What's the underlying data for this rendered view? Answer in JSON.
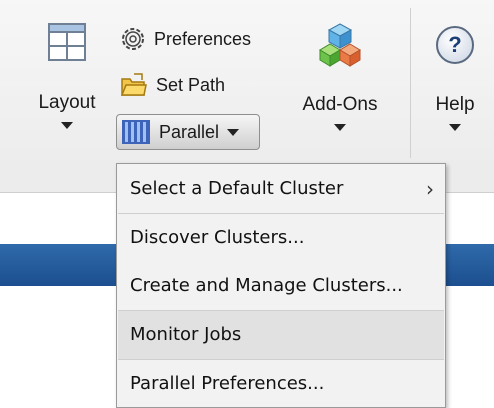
{
  "toolstrip": {
    "layout": {
      "label": "Layout",
      "icon": "layout-grid-icon"
    },
    "preferences": {
      "label": "Preferences",
      "icon": "gear-icon"
    },
    "set_path": {
      "label": "Set Path",
      "icon": "folder-icon"
    },
    "parallel": {
      "label": "Parallel",
      "icon": "parallel-bars-icon"
    },
    "addons": {
      "label": "Add-Ons",
      "icon": "addons-cubes-icon"
    },
    "help": {
      "label": "Help",
      "icon": "help-icon",
      "glyph": "?"
    }
  },
  "parallel_menu": {
    "items": [
      {
        "label": "Select a Default Cluster",
        "submenu_glyph": "›"
      },
      {
        "label": "Discover Clusters..."
      },
      {
        "label": "Create and Manage Clusters..."
      },
      {
        "label": "Monitor Jobs"
      },
      {
        "label": "Parallel Preferences..."
      }
    ]
  },
  "colors": {
    "toolstrip_bg": "#ececec",
    "blue_bar": "#24599b",
    "menu_bg": "#f2f2f2",
    "menu_hover": "#e1e1e1"
  }
}
